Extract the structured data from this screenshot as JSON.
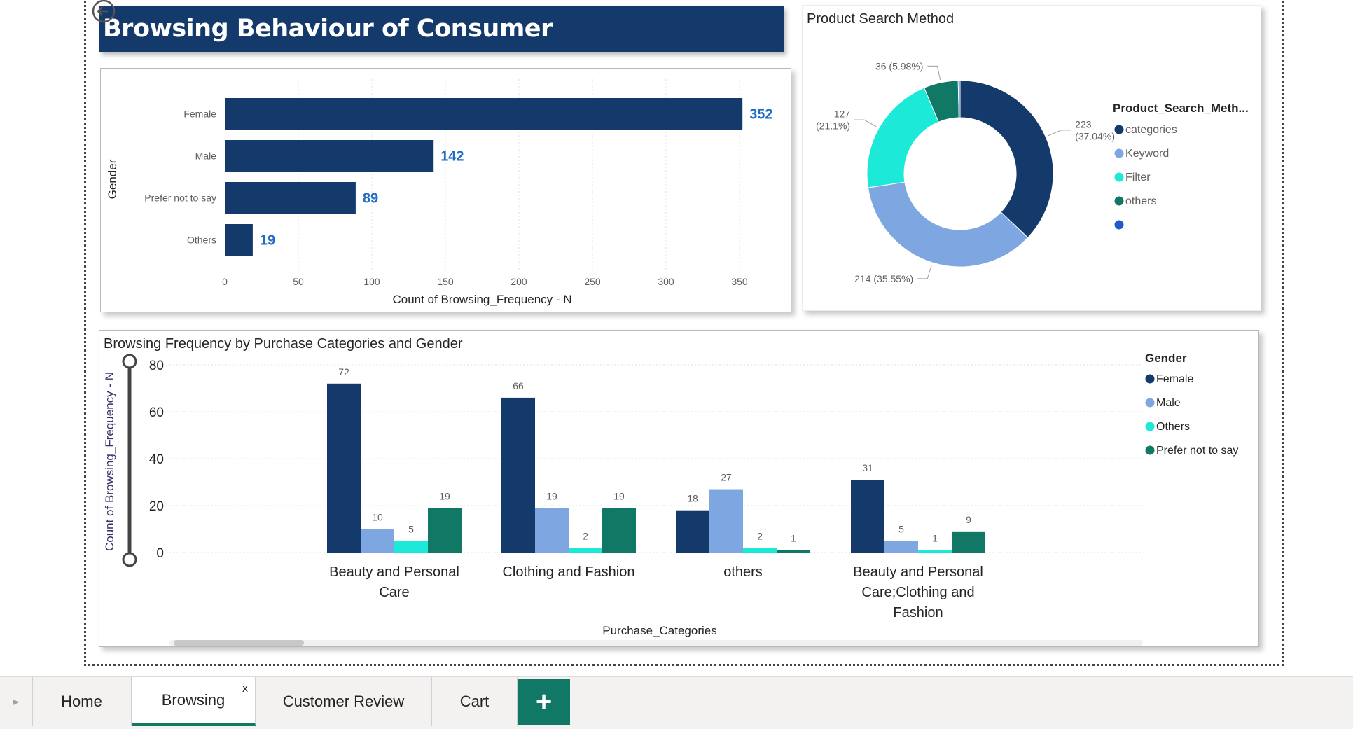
{
  "title": "Browsing Behaviour of Consumer",
  "gender_chart": {
    "chart_data": {
      "type": "bar",
      "orientation": "horizontal",
      "categories": [
        "Female",
        "Male",
        "Prefer not to say",
        "Others"
      ],
      "values": [
        352,
        142,
        89,
        19
      ],
      "xlabel": "Count of Browsing_Frequency - N",
      "ylabel": "Gender",
      "xlim": [
        0,
        360
      ],
      "xticks": [
        0,
        50,
        100,
        150,
        200,
        250,
        300,
        350
      ],
      "color": "#143a6b",
      "label_color": "#1f6cc5"
    }
  },
  "search_chart": {
    "title": "Product Search Method",
    "legend_title": "Product_Search_Meth...",
    "chart_data": {
      "type": "pie",
      "donut": true,
      "slices": [
        {
          "name": "categories",
          "value": 223,
          "label": "223\n(37.04%)",
          "color": "#143a6b"
        },
        {
          "name": "Keyword",
          "value": 214,
          "label": "214 (35.55%)",
          "color": "#7ea6e0"
        },
        {
          "name": "Filter",
          "value": 127,
          "label": "127\n(21.1%)",
          "color": "#1de9d9"
        },
        {
          "name": "others",
          "value": 36,
          "label": "36 (5.98%)",
          "color": "#117865"
        },
        {
          "name": "",
          "value": 2,
          "label": "",
          "color": "#1f5bc4"
        }
      ]
    }
  },
  "category_chart": {
    "title": "Browsing Frequency by Purchase Categories and Gender",
    "legend_title": "Gender",
    "chart_data": {
      "type": "bar",
      "categories": [
        "Beauty and Personal Care",
        "Clothing and Fashion",
        "others",
        "Beauty and Personal Care;Clothing and Fashion"
      ],
      "series": [
        {
          "name": "Female",
          "values": [
            72,
            66,
            18,
            31
          ],
          "color": "#143a6b"
        },
        {
          "name": "Male",
          "values": [
            10,
            19,
            27,
            5
          ],
          "color": "#7ea6e0"
        },
        {
          "name": "Others",
          "values": [
            5,
            2,
            2,
            1
          ],
          "color": "#1de9d9"
        },
        {
          "name": "Prefer not to say",
          "values": [
            19,
            19,
            1,
            9
          ],
          "color": "#117865"
        }
      ],
      "xlabel": "Purchase_Categories",
      "ylabel": "Count of Browsing_Frequency - N",
      "ylim": [
        0,
        80
      ],
      "yticks": [
        0,
        20,
        40,
        60,
        80
      ]
    }
  },
  "tabs": [
    {
      "label": "Home",
      "active": false
    },
    {
      "label": "Browsing",
      "active": true
    },
    {
      "label": "Customer Review",
      "active": false
    },
    {
      "label": "Cart",
      "active": false
    }
  ],
  "tab_close_label": "x",
  "add_tab_label": "+"
}
